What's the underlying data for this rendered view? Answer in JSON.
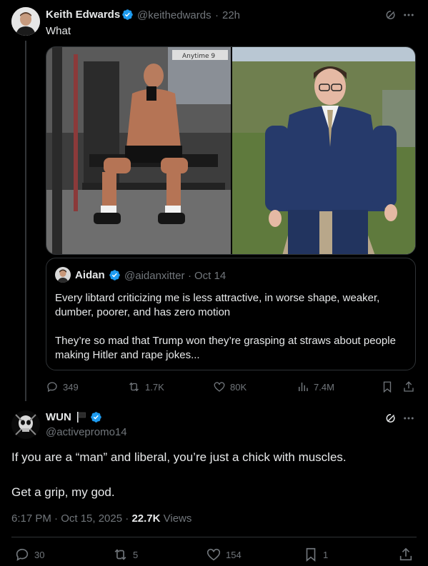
{
  "post1": {
    "author_name": "Keith Edwards",
    "author_handle": "@keithedwards",
    "time": "22h",
    "text": "What",
    "quote": {
      "author_name": "Aidan",
      "author_handle": "@aidanxitter",
      "time": "Oct 14",
      "paragraph1": "Every libtard criticizing me is less attractive, in worse shape, weaker, dumber, poorer, and has zero motion",
      "paragraph2": "They’re so mad that Trump won they’re grasping at straws about people making Hitler and rape jokes..."
    },
    "media_sign_text": "Anytime 9",
    "stats": {
      "replies": "349",
      "reposts": "1.7K",
      "likes": "80K",
      "views": "7.4M"
    }
  },
  "post2": {
    "author_name": "WUN",
    "author_handle": "@activepromo14",
    "paragraph1": "If you are a “man” and liberal, you’re just a chick with muscles.",
    "paragraph2": "Get a grip, my god.",
    "timestamp": "6:17 PM · Oct 15, 2025",
    "views_count": "22.7K",
    "views_label": "Views",
    "stats": {
      "replies": "30",
      "reposts": "5",
      "likes": "154",
      "bookmarks": "1"
    }
  },
  "colors": {
    "background": "#000000",
    "text": "#e7e9ea",
    "muted": "#71767b",
    "verified": "#1d9bf0",
    "border": "#2f3336"
  },
  "icons": [
    "grok-icon",
    "more-icon",
    "verified-badge-icon",
    "flag-icon",
    "reply-icon",
    "repost-icon",
    "like-icon",
    "views-icon",
    "bookmark-icon",
    "share-icon"
  ]
}
